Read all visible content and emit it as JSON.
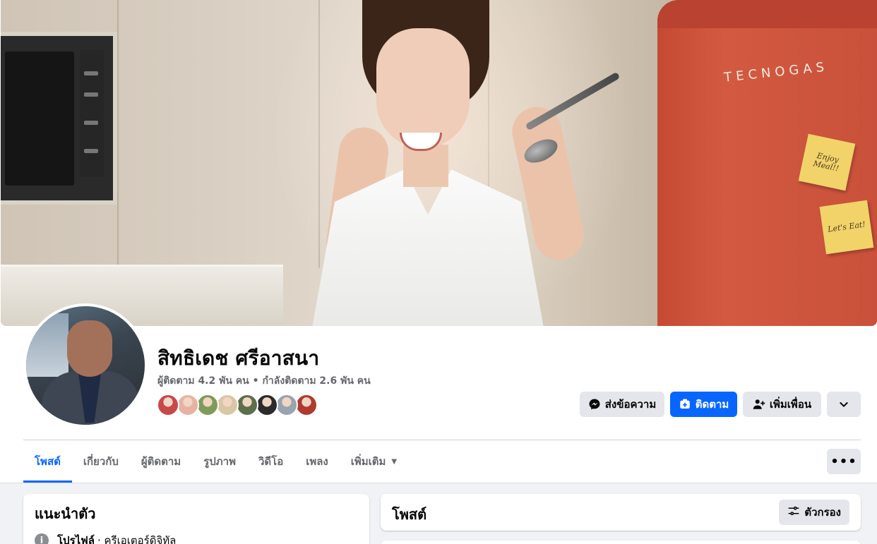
{
  "cover": {
    "fridge_brand": "TECNOGAS",
    "note1_text": "Enjoy Meal!!",
    "note2_text": "Let's Eat!"
  },
  "profile": {
    "name": "สิทธิเดช ศรีอาสนา",
    "followers": "ผู้ติดตาม 4.2 พัน คน",
    "separator": " • ",
    "following": "กำลังติดตาม 2.6 พัน คน",
    "friend_avatar_colors": [
      "#c9484a",
      "#e8b2a3",
      "#7f9b5a",
      "#d9c7a4",
      "#5c6e4a",
      "#2b2b2b",
      "#9aa3b0",
      "#b03a2e"
    ]
  },
  "actions": {
    "message_label": "ส่งข้อความ",
    "follow_label": "ติดตาม",
    "add_friend_label": "เพิ่มเพื่อน",
    "more_icon": "chevron-down-icon"
  },
  "tabs": {
    "items": [
      {
        "label": "โพสต์"
      },
      {
        "label": "เกี่ยวกับ"
      },
      {
        "label": "ผู้ติดตาม"
      },
      {
        "label": "รูปภาพ"
      },
      {
        "label": "วิดีโอ"
      },
      {
        "label": "เพลง"
      },
      {
        "label": "เพิ่มเติม"
      }
    ],
    "more_options_icon": "ellipsis-icon"
  },
  "intro": {
    "title": "แนะนำตัว",
    "profile_label": "โปรไฟล์",
    "profile_value": "· ครีเอเตอร์ดิจิทัล"
  },
  "posts": {
    "title": "โพสต์",
    "filter_label": "ตัวกรอง"
  },
  "colors": {
    "accent": "#0866ff",
    "button_gray": "#e4e6eb",
    "page_bg": "#f0f2f5"
  }
}
